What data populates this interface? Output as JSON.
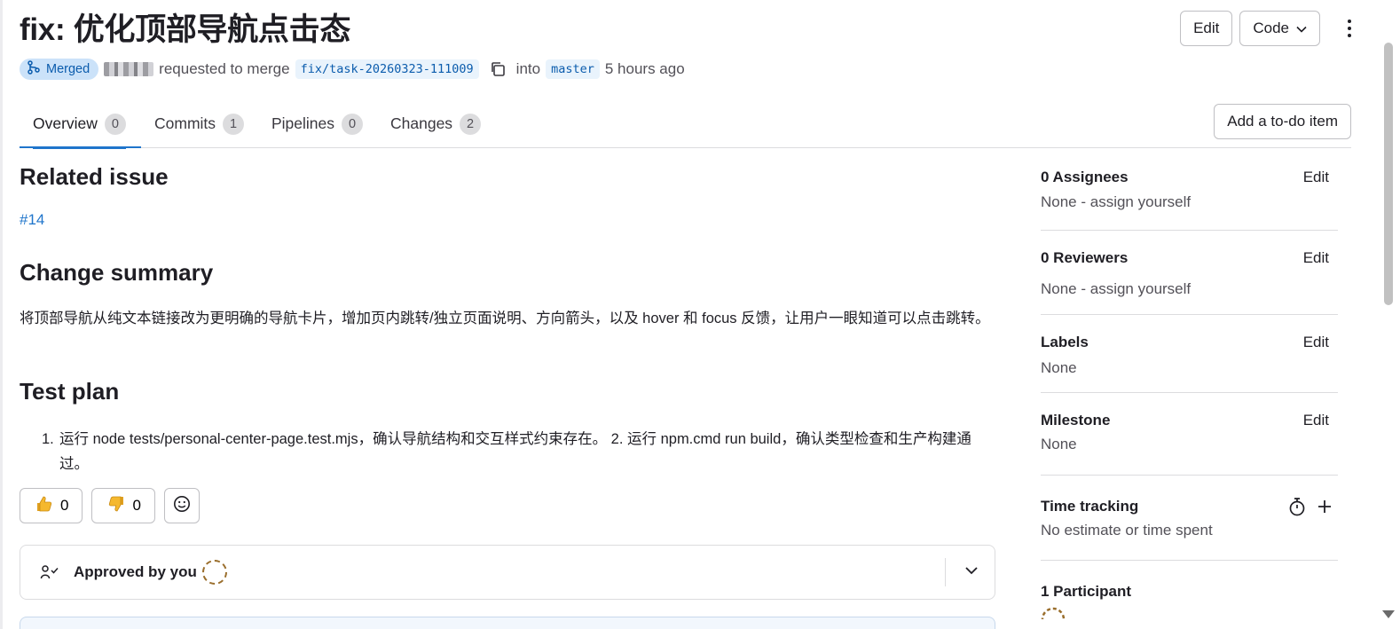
{
  "header": {
    "title": "fix: 优化顶部导航点击态",
    "edit_label": "Edit",
    "code_label": "Code",
    "status_badge": "Merged",
    "requested_text": "requested to merge",
    "source_branch": "fix/task-20260323-111009",
    "into_text": "into",
    "target_branch": "master",
    "time_ago": "5 hours ago"
  },
  "tabs": [
    {
      "label": "Overview",
      "count": "0"
    },
    {
      "label": "Commits",
      "count": "1"
    },
    {
      "label": "Pipelines",
      "count": "0"
    },
    {
      "label": "Changes",
      "count": "2"
    }
  ],
  "todo_label": "Add a to-do item",
  "description": {
    "related_issue_heading": "Related issue",
    "issue_link": "#14",
    "change_summary_heading": "Change summary",
    "change_summary_text": "将顶部导航从纯文本链接改为更明确的导航卡片，增加页内跳转/独立页面说明、方向箭头，以及 hover 和 focus 反馈，让用户一眼知道可以点击跳转。",
    "test_plan_heading": "Test plan",
    "test_plan_number": "1.",
    "test_plan_text": "运行 node tests/personal-center-page.test.mjs，确认导航结构和交互样式约束存在。 2. 运行 npm.cmd run build，确认类型检查和生产构建通过。"
  },
  "reactions": {
    "thumbs_up_count": "0",
    "thumbs_down_count": "0"
  },
  "approvals": {
    "text": "Approved by you"
  },
  "sidebar": {
    "edit_label": "Edit",
    "assignees": {
      "title": "0 Assignees",
      "value": "None - assign yourself"
    },
    "reviewers": {
      "title": "0 Reviewers",
      "value": "None - assign yourself"
    },
    "labels": {
      "title": "Labels",
      "value": "None"
    },
    "milestone": {
      "title": "Milestone",
      "value": "None"
    },
    "time_tracking": {
      "title": "Time tracking",
      "value": "No estimate or time spent"
    },
    "participants": {
      "title": "1 Participant"
    }
  },
  "colors": {
    "accent": "#1f75cb",
    "merged_badge_bg": "#cbe2f9",
    "merged_badge_text": "#0b5cad"
  }
}
